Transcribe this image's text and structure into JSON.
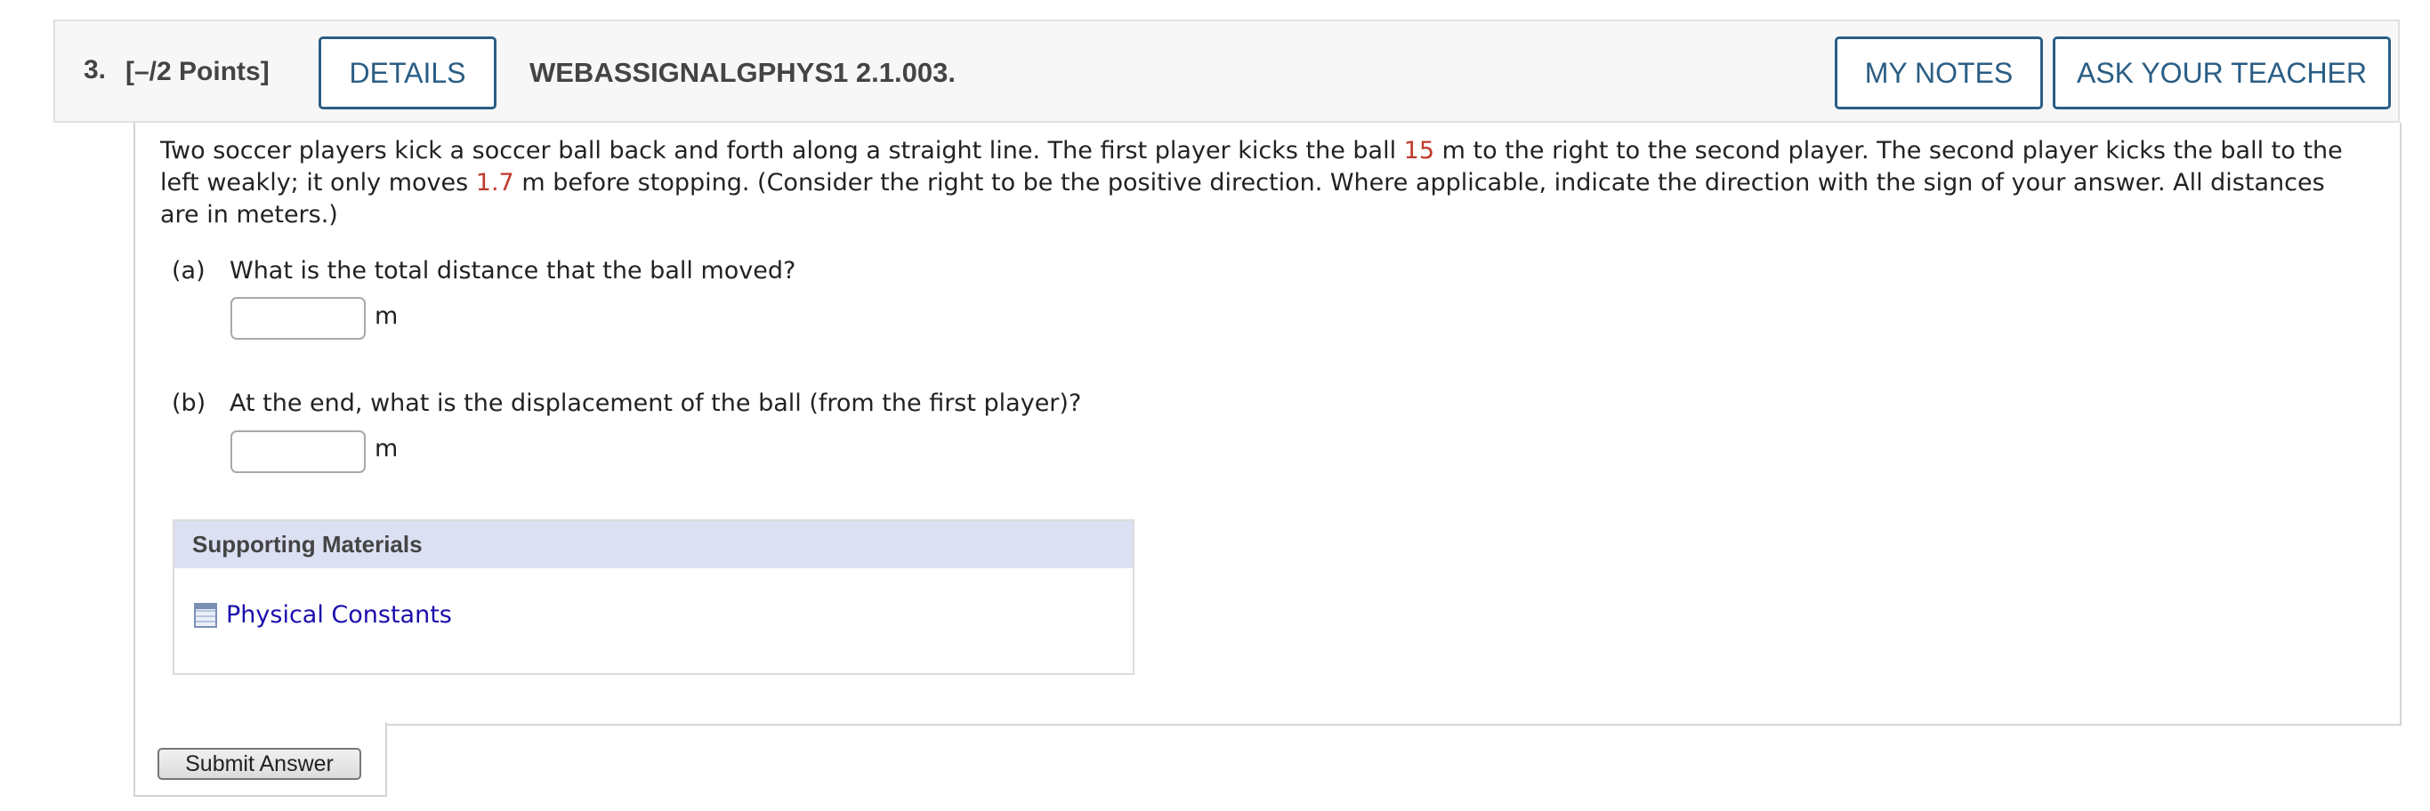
{
  "question": {
    "number": "3.",
    "points": "[–/2 Points]",
    "details_label": "DETAILS",
    "id": "WEBASSIGNALGPHYS1 2.1.003.",
    "my_notes_label": "MY NOTES",
    "ask_teacher_label": "ASK YOUR TEACHER"
  },
  "prompt": {
    "line1_a": "Two soccer players kick a soccer ball back and forth along a straight line. The first player kicks the ball ",
    "value1": "15",
    "line1_b": " m to the right to the second player. The second player kicks the ball to the left weakly; it only moves ",
    "value2": "1.7",
    "line1_c": " m before stopping. (Consider the right to be the positive direction. Where applicable, indicate the direction with the sign of your answer. All distances are in meters.)"
  },
  "parts": [
    {
      "label": "(a)",
      "question": "What is the total distance that the ball moved?",
      "value": "",
      "unit": "m"
    },
    {
      "label": "(b)",
      "question": "At the end, what is the displacement of the ball (from the first player)?",
      "value": "",
      "unit": "m"
    }
  ],
  "supporting": {
    "title": "Supporting Materials",
    "link": "Physical Constants",
    "icon": "table-icon"
  },
  "submit_label": "Submit Answer",
  "colors": {
    "accent": "#2a5d84",
    "given_value": "#c0392b",
    "link": "#1a0dab",
    "support_header": "#dbe0f3"
  }
}
